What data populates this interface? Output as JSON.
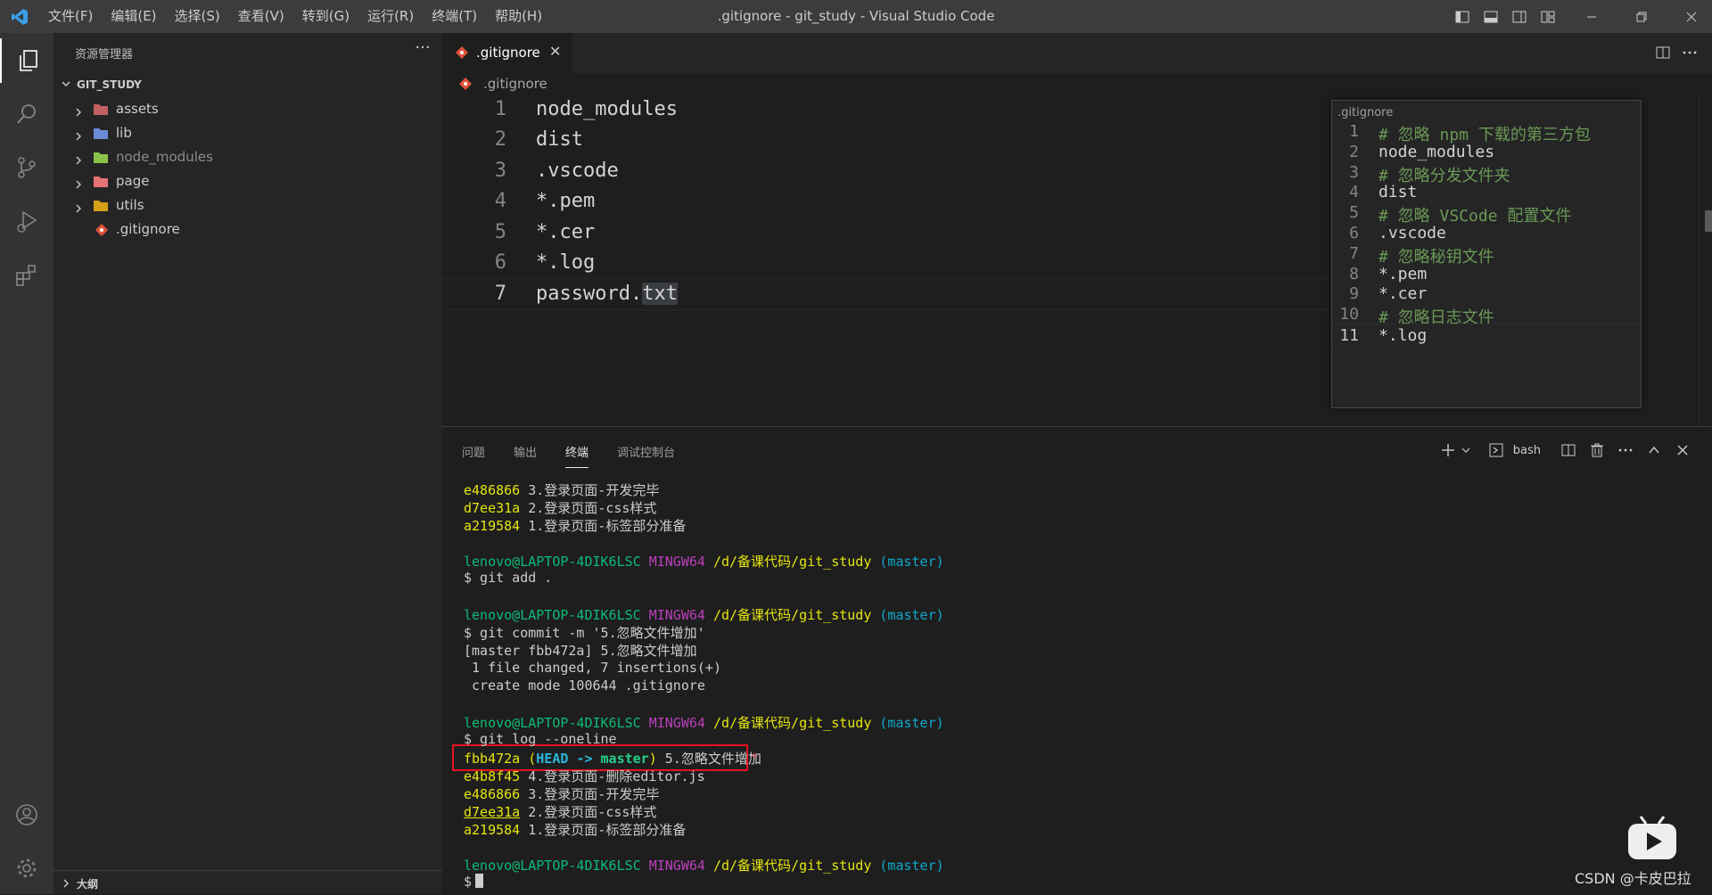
{
  "window": {
    "title": ".gitignore - git_study - Visual Studio Code",
    "menu": [
      "文件(F)",
      "编辑(E)",
      "选择(S)",
      "查看(V)",
      "转到(G)",
      "运行(R)",
      "终端(T)",
      "帮助(H)"
    ]
  },
  "activity_bar": {
    "items": [
      "explorer-icon",
      "search-icon",
      "source-control-icon",
      "run-debug-icon",
      "extensions-icon"
    ],
    "bottom": [
      "account-icon",
      "manage-gear-icon"
    ]
  },
  "sidebar": {
    "title": "资源管理器",
    "more": "···",
    "folder": "GIT_STUDY",
    "items": [
      {
        "label": "assets",
        "type": "folder",
        "icon_color": "#c06060"
      },
      {
        "label": "lib",
        "type": "folder",
        "icon_color": "#6a8bd8"
      },
      {
        "label": "node_modules",
        "type": "folder",
        "icon_color": "#8bc34a"
      },
      {
        "label": "page",
        "type": "folder",
        "icon_color": "#e57373"
      },
      {
        "label": "utils",
        "type": "folder",
        "icon_color": "#d4a017"
      },
      {
        "label": ".gitignore",
        "type": "file",
        "icon_color": "#e0533c"
      }
    ],
    "outline": "大纲"
  },
  "editor": {
    "tab": ".gitignore",
    "tab_close": "✕",
    "breadcrumb": ".gitignore",
    "lines": [
      {
        "n": "1",
        "text": "node_modules"
      },
      {
        "n": "2",
        "text": "dist"
      },
      {
        "n": "3",
        "text": ".vscode"
      },
      {
        "n": "4",
        "text": "*.pem"
      },
      {
        "n": "5",
        "text": "*.cer"
      },
      {
        "n": "6",
        "text": "*.log"
      },
      {
        "n": "7",
        "text_before": "password.",
        "text_selected": "txt"
      }
    ]
  },
  "preview": {
    "title": ".gitignore",
    "lines": [
      {
        "n": "1",
        "text": "# 忽略 npm 下载的第三方包",
        "comment": true
      },
      {
        "n": "2",
        "text": "node_modules",
        "comment": false
      },
      {
        "n": "3",
        "text": "# 忽略分发文件夹",
        "comment": true
      },
      {
        "n": "4",
        "text": "dist",
        "comment": false
      },
      {
        "n": "5",
        "text": "# 忽略 VSCode 配置文件",
        "comment": true
      },
      {
        "n": "6",
        "text": ".vscode",
        "comment": false
      },
      {
        "n": "7",
        "text": "# 忽略秘钥文件",
        "comment": true
      },
      {
        "n": "8",
        "text": "*.pem",
        "comment": false
      },
      {
        "n": "9",
        "text": "*.cer",
        "comment": false
      },
      {
        "n": "10",
        "text": "# 忽略日志文件",
        "comment": true
      },
      {
        "n": "11",
        "text": "*.log",
        "comment": false
      }
    ]
  },
  "panel": {
    "tabs": [
      "问题",
      "输出",
      "终端",
      "调试控制台"
    ],
    "active_tab": "终端",
    "shell": "bash",
    "terminal": [
      {
        "hash": "e486866",
        "msg": " 3.登录页面-开发完毕"
      },
      {
        "hash": "d7ee31a",
        "msg": " 2.登录页面-css样式"
      },
      {
        "hash": "a219584",
        "msg": " 1.登录页面-标签部分准备"
      },
      {
        "blank": true
      },
      {
        "prompt": true
      },
      {
        "plain": "$ git add ."
      },
      {
        "blank": true
      },
      {
        "prompt": true
      },
      {
        "plain": "$ git commit -m '5.忽略文件增加'"
      },
      {
        "plain": "[master fbb472a] 5.忽略文件增加"
      },
      {
        "plain": " 1 file changed, 7 insertions(+)"
      },
      {
        "plain": " create mode 100644 .gitignore"
      },
      {
        "blank": true
      },
      {
        "prompt": true
      },
      {
        "plain": "$ git log --oneline"
      },
      {
        "head": true,
        "hash": "fbb472a",
        "msg": " 5.忽略文件增加"
      },
      {
        "hash": "e4b8f45",
        "msg": " 4.登录页面-删除editor.js"
      },
      {
        "hash": "e486866",
        "msg": " 3.登录页面-开发完毕"
      },
      {
        "hash": "d7ee31a",
        "msg": " 2.登录页面-css样式",
        "underline": true
      },
      {
        "hash": "a219584",
        "msg": " 1.登录页面-标签部分准备"
      },
      {
        "blank": true
      },
      {
        "prompt": true
      },
      {
        "cursor": true
      }
    ],
    "prompt": {
      "user": "lenovo@LAPTOP-4DIK6LSC",
      "env": "MINGW64",
      "path": "/d/备课代码/git_study",
      "branch": "(master)"
    },
    "head_label": "HEAD",
    "arrow": "->",
    "branch_label": "master",
    "dollar": "$"
  },
  "watermark": "CSDN @卡皮巴拉",
  "colors": {
    "accent": "#0078d4",
    "highlight": "#e81123",
    "terminal_hash": "#e5e510",
    "prompt_user": "#0dbc79",
    "prompt_env": "#bc3fbc",
    "prompt_branch": "#11a8cd"
  }
}
